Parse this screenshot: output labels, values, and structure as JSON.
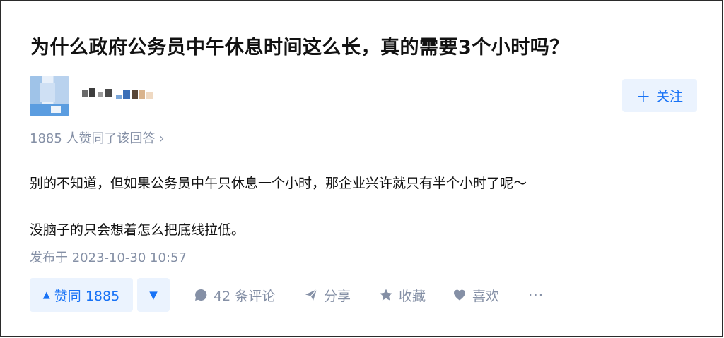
{
  "question": {
    "title": "为什么政府公务员中午休息时间这么长，真的需要3个小时吗？"
  },
  "author": {
    "follow_label": "关注"
  },
  "upvote_summary": "1885 人赞同了该回答 ›",
  "answer": {
    "paragraphs": [
      "别的不知道，但如果公务员中午只休息一个小时，那企业兴许就只有半个小时了呢～",
      "没脑子的只会想着怎么把底线拉低。"
    ],
    "publish_time": "发布于 2023-10-30 10:57"
  },
  "actions": {
    "vote_up_label": "赞同 1885",
    "comments_label": "42 条评论",
    "share_label": "分享",
    "collect_label": "收藏",
    "like_label": "喜欢",
    "more_label": "···"
  },
  "colors": {
    "accent": "#1772f6",
    "accent_bg": "#ebf3fe",
    "muted": "#8590a6"
  },
  "icons": {
    "follow": "plus-icon",
    "vote_up": "triangle-up-icon",
    "vote_down": "triangle-down-icon",
    "comments": "comment-bubble-icon",
    "share": "paper-plane-icon",
    "collect": "star-icon",
    "like": "heart-icon",
    "more": "more-icon"
  }
}
